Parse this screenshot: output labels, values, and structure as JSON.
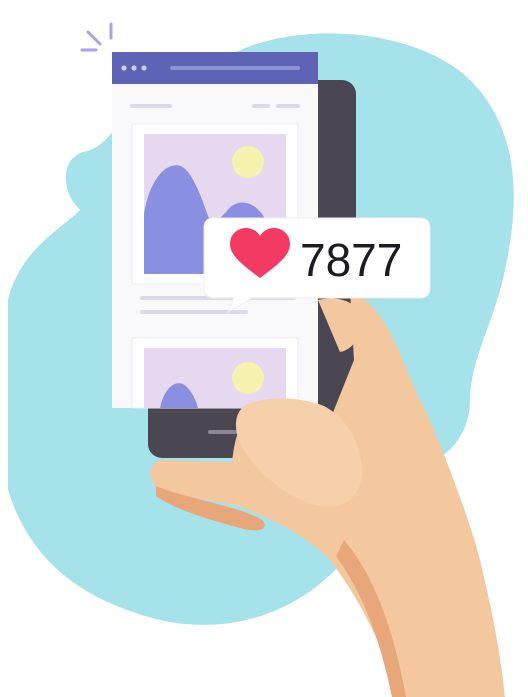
{
  "like_bubble": {
    "icon": "heart-icon",
    "count": "7877"
  },
  "colors": {
    "blob": "#a5e2ea",
    "phone_body": "#4a4752",
    "app_header": "#5e63b5",
    "heart": "#f23a63",
    "image_bg": "#e6d8ee",
    "mountain": "#8a8fe2",
    "sun": "#f7f2b0",
    "skin": "#f4c89e",
    "skin_shadow": "#e7a77a"
  }
}
